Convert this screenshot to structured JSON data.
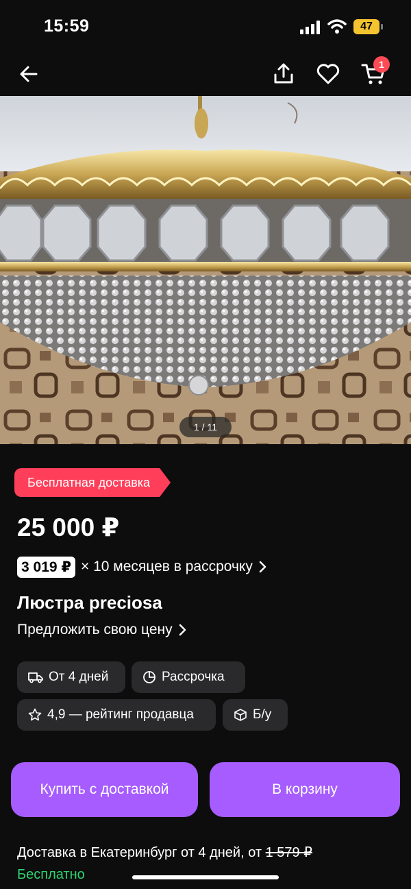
{
  "status_bar": {
    "time": "15:59",
    "battery": "47"
  },
  "nav": {
    "cart_count": "1"
  },
  "gallery": {
    "counter": "1 / 11"
  },
  "product": {
    "badge": "Бесплатная доставка",
    "price": "25 000 ₽",
    "installment_amount": "3 019 ₽",
    "installment_text": "× 10 месяцев в рассрочку",
    "title": "Люстра preciosa",
    "offer_link": "Предложить свою цену"
  },
  "chips": {
    "delivery": "От 4 дней",
    "installment": "Рассрочка",
    "rating": "4,9 — рейтинг продавца",
    "condition": "Б/у"
  },
  "actions": {
    "buy": "Купить с доставкой",
    "add_to_cart": "В корзину"
  },
  "delivery": {
    "text": "Доставка в Екатеринбург от 4 дней, от",
    "old_price": "1 579 ₽",
    "free": "Бесплатно"
  },
  "colors": {
    "background": "#0d0d0d",
    "accent": "#a65cff",
    "badge": "#ff3e5a",
    "free_text": "#2dd36f",
    "chip": "#2a2a2c"
  },
  "icons": [
    "back-arrow-icon",
    "share-icon",
    "heart-icon",
    "cart-icon",
    "truck-icon",
    "pie-chart-icon",
    "star-icon",
    "box-icon",
    "chevron-right-icon"
  ]
}
